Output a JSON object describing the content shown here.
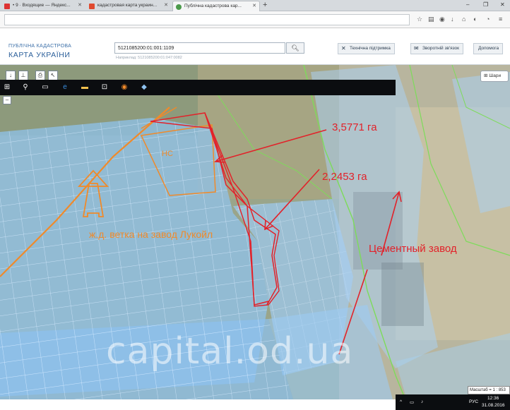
{
  "browser": {
    "tabs": [
      {
        "label": "• 9 · Входящие — Яндекс...",
        "favicon_color": "#d33"
      },
      {
        "label": "кадастровая карта украин...",
        "favicon_color": "#e04a2f"
      },
      {
        "label": "Публічна кадастрова кар...",
        "favicon_color": "#4b9a4b"
      }
    ],
    "new_tab": "+",
    "window_controls": [
      "–",
      "❐",
      "✕"
    ]
  },
  "site": {
    "brand_small": "ПУБЛІЧНА КАДАСТРОВА",
    "brand_large": "КАРТА УКРАЇНИ",
    "search_value": "5121085200:01:001:1109",
    "search_hint": "Наприклад: 5121085200:01:047:0082",
    "buttons": {
      "support": "Технічна підтримка",
      "feedback": "Зворотній зв'язок",
      "help": "Допомога"
    },
    "layers_label": "Шари"
  },
  "annotations": {
    "area1": "3,5771 га",
    "area2": "2,2453 га",
    "cement_plant": "Цементный завод",
    "branch_line": "ж.д. ветка на завод Лукойл",
    "plot_label": "НС",
    "watermark": "capital.od.ua"
  },
  "map": {
    "scale_text": "Масштаб = 1 : 853"
  },
  "taskbar": {
    "language": "РУС",
    "time": "12:36",
    "date": "31.08.2016"
  },
  "colors": {
    "annotation_red": "#e2222a",
    "annotation_orange": "#f08a2a",
    "parcel_blue": "#8fc3f0",
    "boundary_green": "#7ddc5a"
  }
}
